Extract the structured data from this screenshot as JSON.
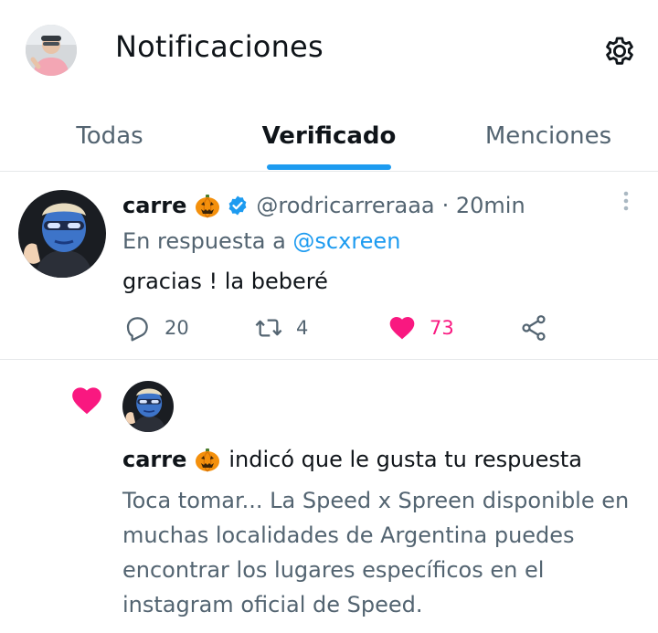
{
  "header": {
    "title": "Notificaciones",
    "avatar_icon": "user-avatar",
    "settings_icon": "gear-icon"
  },
  "tabs": [
    {
      "label": "Todas",
      "active": false
    },
    {
      "label": "Verificado",
      "active": true
    },
    {
      "label": "Menciones",
      "active": false
    }
  ],
  "tweet": {
    "name": "carre",
    "emoji": "pumpkin",
    "handle": "@rodricarreraaa",
    "time": "· 20min",
    "reply_prefix": "En respuesta a",
    "reply_to": "@scxreen",
    "text": "gracias ! la beberé",
    "replies": "20",
    "retweets": "4",
    "likes": "73",
    "liked": true
  },
  "notification": {
    "name": "carre",
    "action_text": "indicó que le gusta tu respuesta",
    "body": "Toca tomar... La Speed x Spreen disponible en muchas localidades de Argentina puedes encontrar los lugares específicos en el instagram oficial de Speed."
  },
  "colors": {
    "accent": "#1d9bf0",
    "like": "#f91880",
    "secondary_text": "#536471",
    "primary_text": "#0f1419"
  }
}
